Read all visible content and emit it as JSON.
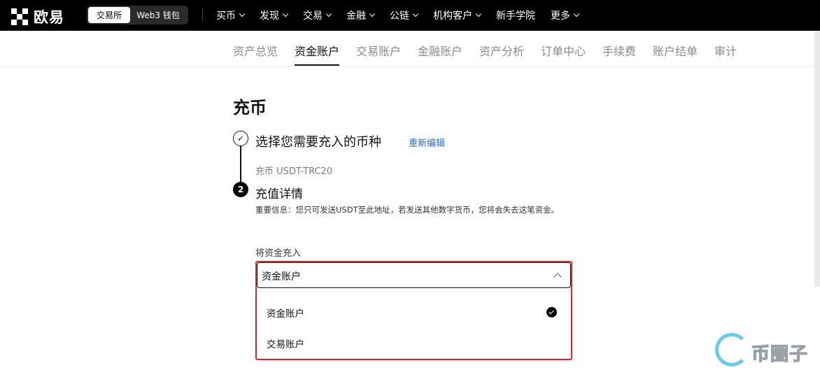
{
  "header": {
    "brand": "欧易",
    "switcher": [
      "交易所",
      "Web3 钱包"
    ],
    "nav": [
      "买币",
      "发现",
      "交易",
      "金融",
      "公链",
      "机构客户",
      "新手学院",
      "更多"
    ]
  },
  "subnav": {
    "items": [
      "资产总览",
      "资金账户",
      "交易账户",
      "金融账户",
      "资产分析",
      "订单中心",
      "手续费",
      "账户结单",
      "审计"
    ],
    "active": "资金账户"
  },
  "page": {
    "title": "充币",
    "step1": {
      "number": "✓",
      "title": "选择您需要充入的币种",
      "edit_link": "重新编辑",
      "selected": "充币 USDT-TRC20"
    },
    "step2": {
      "number": "2",
      "title": "充值详情",
      "notice": "重要信息：您只可发送USDT至此地址，若发送其他数字货币，您将会失去这笔资金。",
      "field_label": "将资金充入",
      "select_value": "资金账户",
      "options": [
        "资金账户",
        "交易账户"
      ],
      "selected_option": "资金账户"
    }
  },
  "watermark": {
    "text": "币圈子"
  }
}
